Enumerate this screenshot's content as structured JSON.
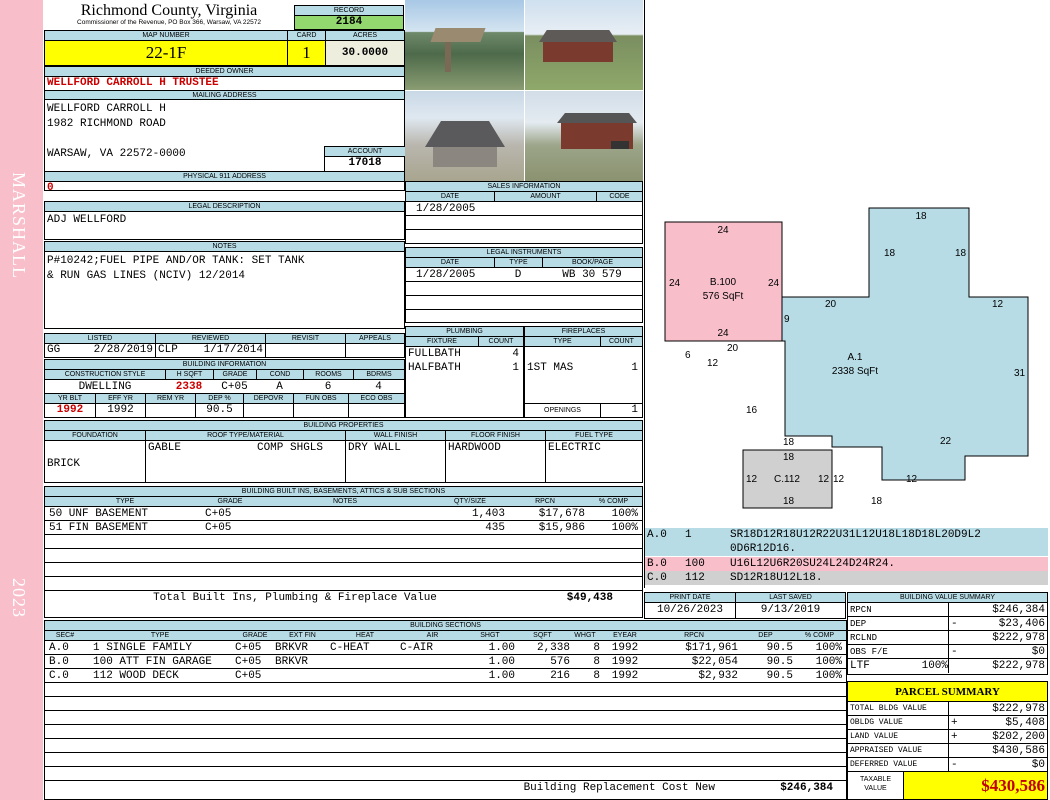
{
  "side": {
    "name": "MARSHALL",
    "year": "2023"
  },
  "header": {
    "county": "Richmond County, Virginia",
    "commissioner": "Commissioner of the Revenue, PO Box 366, Warsaw, VA 22572",
    "record_label": "RECORD",
    "record": "2184",
    "map_label": "MAP NUMBER",
    "map": "22-1F",
    "card_label": "CARD",
    "card": "1",
    "acres_label": "ACRES",
    "acres": "30.0000"
  },
  "owner": {
    "label": "DEEDED OWNER",
    "name": "WELLFORD CARROLL H TRUSTEE",
    "mailing_label": "MAILING ADDRESS",
    "line1": "WELLFORD CARROLL H",
    "line2": "1982 RICHMOND ROAD",
    "line3": "WARSAW, VA 22572-0000",
    "account_label": "ACCOUNT",
    "account": "17018",
    "phys_label": "PHYSICAL 911 ADDRESS",
    "phys": "0"
  },
  "legal": {
    "label": "LEGAL DESCRIPTION",
    "text": "ADJ WELLFORD",
    "notes_label": "NOTES",
    "notes1": "P#10242;FUEL PIPE AND/OR TANK: SET TANK",
    "notes2": "& RUN GAS LINES (NCIV) 12/2014"
  },
  "listed": {
    "listed_label": "LISTED",
    "reviewed_label": "REVIEWED",
    "revisit_label": "REVISIT",
    "appeals_label": "APPEALS",
    "lister": "GG",
    "listed_date": "2/28/2019",
    "reviewer": "CLP",
    "reviewed_date": "1/17/2014"
  },
  "bldg": {
    "label": "BUILDING INFORMATION",
    "h_style": "CONSTRUCTION STYLE",
    "h_sqft": "H SQFT",
    "h_grade": "GRADE",
    "h_cond": "COND",
    "h_rooms": "ROOMS",
    "h_bdrms": "BDRMS",
    "style": "DWELLING",
    "sqft": "2338",
    "grade": "C+05",
    "cond": "A",
    "rooms": "6",
    "bdrms": "4",
    "h_yrblt": "YR BLT",
    "h_effyr": "EFF YR",
    "h_remyr": "REM YR",
    "h_dep": "DEP %",
    "h_depovr": "DEPOVR",
    "h_funobs": "FUN OBS",
    "h_ecoobs": "ECO OBS",
    "yrblt": "1992",
    "effyr": "1992",
    "dep": "90.5"
  },
  "sales": {
    "label": "SALES INFORMATION",
    "h_date": "DATE",
    "h_amount": "AMOUNT",
    "h_code": "CODE",
    "date": "1/28/2005"
  },
  "instr": {
    "label": "LEGAL INSTRUMENTS",
    "h_date": "DATE",
    "h_type": "TYPE",
    "h_book": "BOOK/PAGE",
    "date": "1/28/2005",
    "type": "D",
    "book": "WB 30 579"
  },
  "plumb": {
    "label": "PLUMBING",
    "h_fixture": "FIXTURE",
    "h_count": "COUNT",
    "rows": [
      {
        "f": "FULLBATH",
        "c": "4"
      },
      {
        "f": "HALFBATH",
        "c": "1"
      }
    ]
  },
  "fire": {
    "label": "FIREPLACES",
    "h_type": "TYPE",
    "h_count": "COUNT",
    "type": "1ST MAS",
    "count": "1",
    "openings_label": "OPENINGS",
    "openings": "1"
  },
  "props": {
    "label": "BUILDING PROPERTIES",
    "h_found": "FOUNDATION",
    "h_roof": "ROOF TYPE/MATERIAL",
    "h_wall": "WALL FINISH",
    "h_floor": "FLOOR FINISH",
    "h_fuel": "FUEL TYPE",
    "found": "BRICK",
    "roof1": "GABLE",
    "roof2": "COMP SHGLS",
    "wall": "DRY WALL",
    "floor": "HARDWOOD",
    "fuel": "ELECTRIC"
  },
  "builtins": {
    "label": "BUILDING BUILT INS, BASEMENTS, ATTICS & SUB SECTIONS",
    "h_type": "TYPE",
    "h_grade": "GRADE",
    "h_notes": "NOTES",
    "h_qty": "QTY/SIZE",
    "h_rpcn": "RPCN",
    "h_comp": "% COMP",
    "rows": [
      {
        "type": "50 UNF BASEMENT",
        "grade": "C+05",
        "qty": "1,403",
        "rpcn": "$17,678",
        "comp": "100%"
      },
      {
        "type": "51 FIN BASEMENT",
        "grade": "C+05",
        "qty": "435",
        "rpcn": "$15,986",
        "comp": "100%"
      }
    ],
    "total_label": "Total Built Ins, Plumbing & Fireplace Value",
    "total": "$49,438"
  },
  "sections": {
    "label": "BUILDING SECTIONS",
    "h": [
      "SEC#",
      "TYPE",
      "GRADE",
      "EXT FIN",
      "HEAT",
      "AIR",
      "SHGT",
      "SQFT",
      "WHGT",
      "EYEAR",
      "RPCN",
      "DEP",
      "% COMP"
    ],
    "rows": [
      {
        "sec": "A.0",
        "type": "1 SINGLE FAMILY",
        "grade": "C+05",
        "ext": "BRKVR",
        "heat": "C-HEAT",
        "air": "C-AIR",
        "shgt": "1.00",
        "sqft": "2,338",
        "whgt": "8",
        "eyear": "1992",
        "rpcn": "$171,961",
        "dep": "90.5",
        "comp": "100%"
      },
      {
        "sec": "B.0",
        "type": "100 ATT FIN GARAGE",
        "grade": "C+05",
        "ext": "BRKVR",
        "heat": "",
        "air": "",
        "shgt": "1.00",
        "sqft": "576",
        "whgt": "8",
        "eyear": "1992",
        "rpcn": "$22,054",
        "dep": "90.5",
        "comp": "100%"
      },
      {
        "sec": "C.0",
        "type": "112 WOOD DECK",
        "grade": "C+05",
        "ext": "",
        "heat": "",
        "air": "",
        "shgt": "1.00",
        "sqft": "216",
        "whgt": "8",
        "eyear": "1992",
        "rpcn": "$2,932",
        "dep": "90.5",
        "comp": "100%"
      }
    ],
    "total_label": "Building Replacement Cost New",
    "total": "$246,384"
  },
  "sketch": {
    "a_label": "A.1",
    "a_sqft": "2338 SqFt",
    "b_label": "B.100",
    "b_sqft": "576 SqFt",
    "c_label": "C.112",
    "c_sqft": "",
    "dims": [
      "24",
      "24",
      "24",
      "24",
      "18",
      "18",
      "18",
      "20",
      "12",
      "9",
      "20",
      "6",
      "12",
      "31",
      "16",
      "18",
      "22",
      "12",
      "12",
      "12",
      "18",
      "18",
      "18",
      "12"
    ]
  },
  "vectors": [
    {
      "code": "A.0",
      "num": "1",
      "vec1": "SR18D12R18U12R22U31L12U18L18D18L20D9L2",
      "vec2": "0D6R12D16.",
      "color": "#b8dce6"
    },
    {
      "code": "B.0",
      "num": "100",
      "vec1": "U16L12U6R20SU24L24D24R24.",
      "vec2": "",
      "color": "#f8bfcb"
    },
    {
      "code": "C.0",
      "num": "112",
      "vec1": "SD12R18U12L18.",
      "vec2": "",
      "color": "#d0d0d0"
    }
  ],
  "print": {
    "print_label": "PRINT DATE",
    "saved_label": "LAST SAVED",
    "print_date": "10/26/2023",
    "saved_date": "9/13/2019"
  },
  "bvs": {
    "label": "BUILDING VALUE SUMMARY",
    "rows": [
      {
        "k": "RPCN",
        "s": "",
        "v": "$246,384"
      },
      {
        "k": "DEP",
        "s": "-",
        "v": "$23,406"
      },
      {
        "k": "RCLND",
        "s": "",
        "v": "$222,978"
      },
      {
        "k": "OBS F/E",
        "s": "-",
        "v": "$0"
      },
      {
        "k": "LTF",
        "p": "100%",
        "s": "",
        "v": "$222,978"
      }
    ]
  },
  "parcel": {
    "label": "PARCEL SUMMARY",
    "rows": [
      {
        "k": "TOTAL BLDG VALUE",
        "s": "",
        "v": "$222,978"
      },
      {
        "k": "OBLDG VALUE",
        "s": "+",
        "v": "$5,408"
      },
      {
        "k": "LAND VALUE",
        "s": "+",
        "v": "$202,200"
      },
      {
        "k": "APPRAISED VALUE",
        "s": "",
        "v": "$430,586"
      },
      {
        "k": "DEFERRED VALUE",
        "s": "-",
        "v": "$0"
      }
    ],
    "taxable_label1": "TAXABLE",
    "taxable_label2": "VALUE",
    "taxable": "$430,586"
  },
  "colors": {
    "header_blue": "#b8dce6",
    "yellow": "#ffff00",
    "green": "#92d86e",
    "pink": "#f8bfcb",
    "red": "#c00000"
  }
}
